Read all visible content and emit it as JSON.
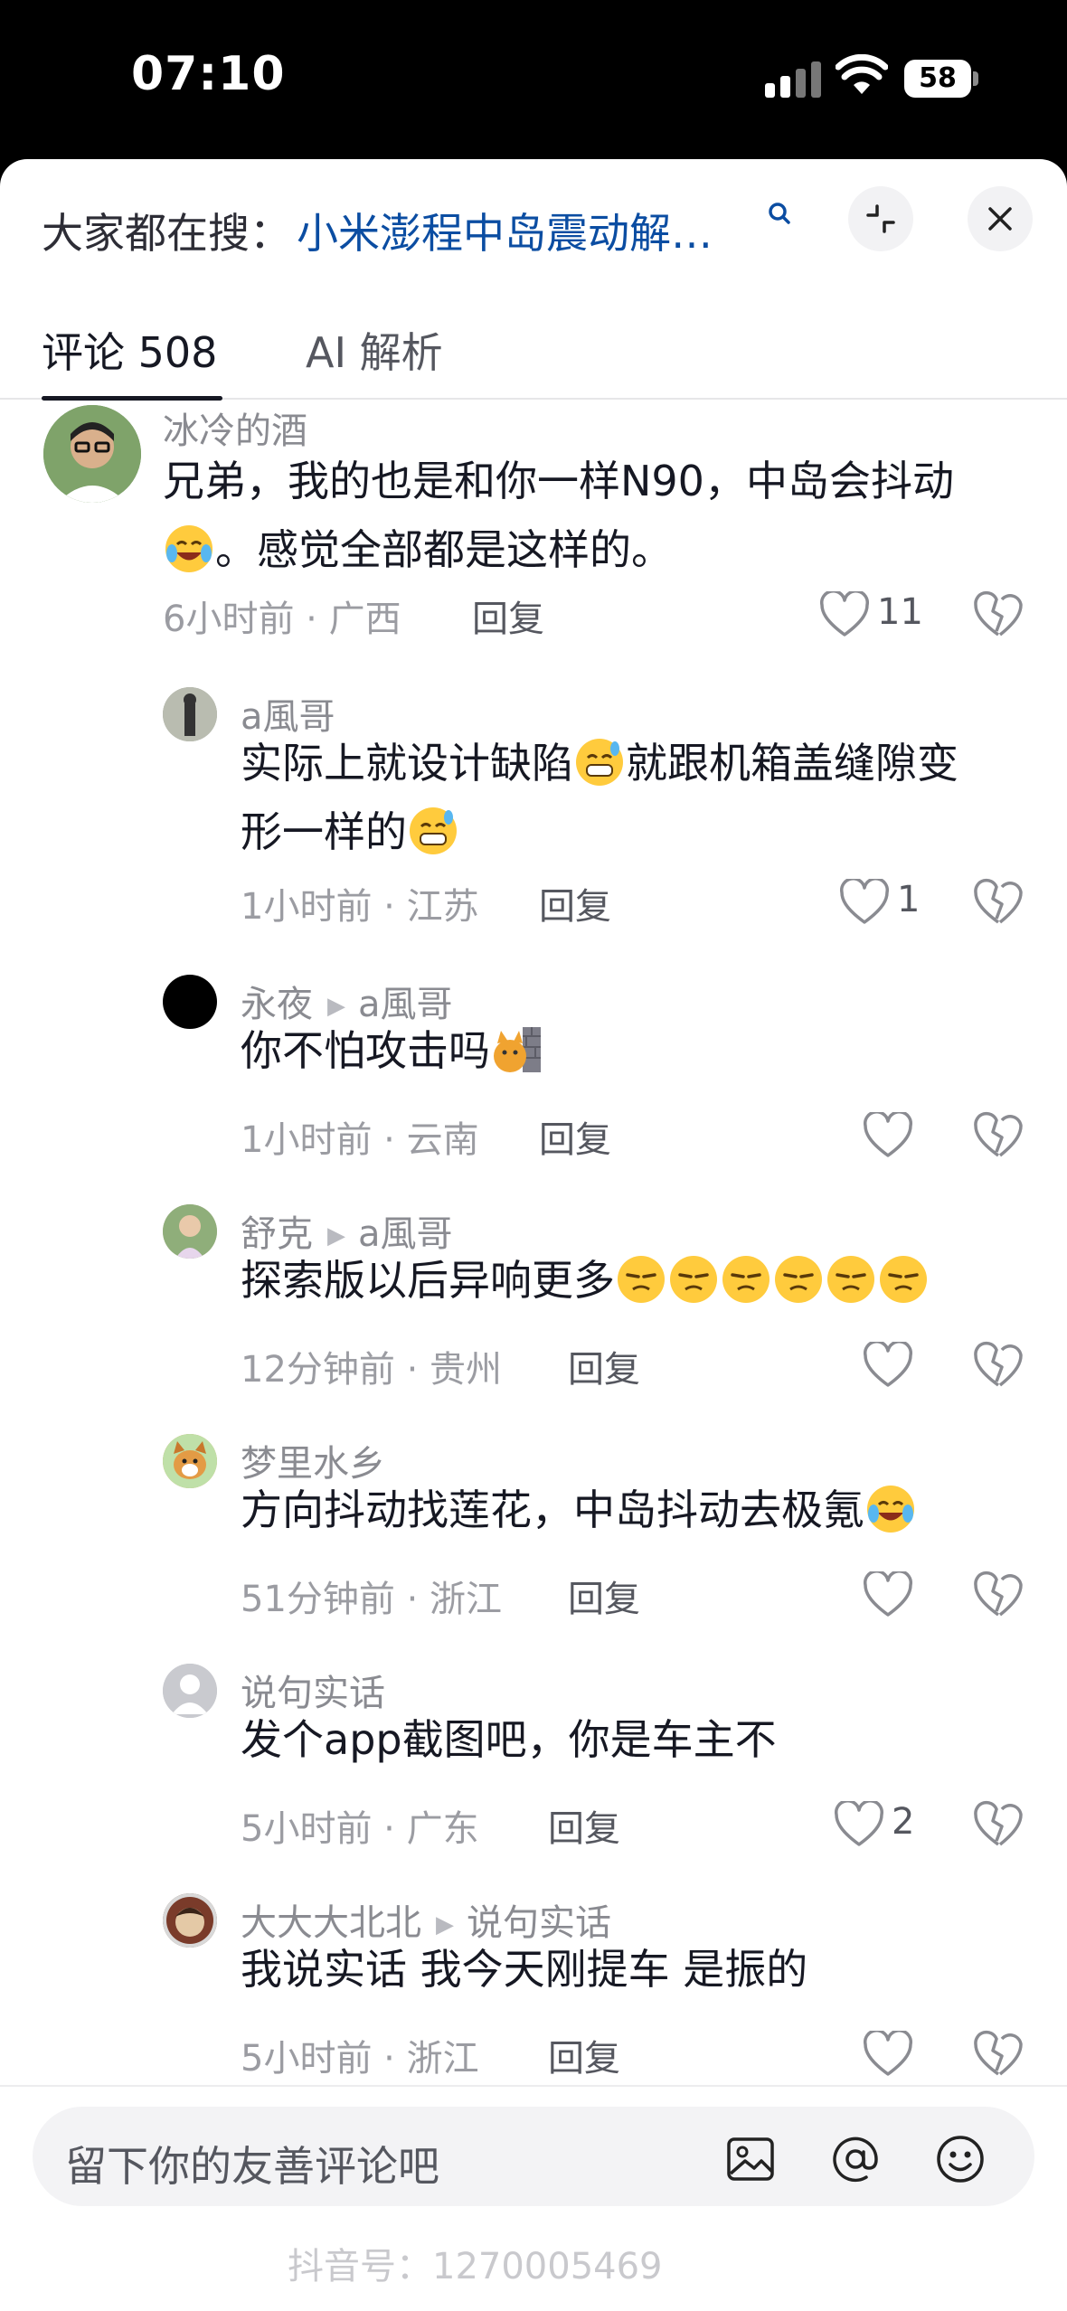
{
  "status": {
    "time": "07:10",
    "battery": "58"
  },
  "search": {
    "prefix": "大家都在搜：",
    "query": "小米澎程中岛震动解…"
  },
  "tabs": {
    "comments": "评论 508",
    "ai": "AI 解析"
  },
  "reply_label": "回复",
  "comments": [
    {
      "author": "冰冷的酒",
      "line1": "兄弟，我的也是和你一样N90，中岛会抖动",
      "line2": "。感觉全部都是这样的。",
      "meta": "6小时前 · 广西",
      "likes": "11"
    },
    {
      "author": "a風哥",
      "line1": "实际上就设计缺陷",
      "line1b": "就跟机箱盖缝隙变",
      "line2": "形一样的",
      "meta": "1小时前 · 江苏",
      "likes": "1"
    },
    {
      "author": "永夜",
      "reply_to": "a風哥",
      "line1": "你不怕攻击吗",
      "meta": "1小时前 · 云南",
      "likes": ""
    },
    {
      "author": "舒克",
      "reply_to": "a風哥",
      "line1": "探索版以后异响更多",
      "meta": "12分钟前 · 贵州",
      "likes": ""
    },
    {
      "author": "梦里水乡",
      "line1": "方向抖动找莲花，中岛抖动去极氪",
      "meta": "51分钟前 · 浙江",
      "likes": ""
    },
    {
      "author": "说句实话",
      "line1": "发个app截图吧，你是车主不",
      "meta": "5小时前 · 广东",
      "likes": "2"
    },
    {
      "author": "大大大北北",
      "reply_to": "说句实话",
      "line1": "我说实话 我今天刚提车 是振的",
      "meta": "5小时前 · 浙江",
      "likes": ""
    }
  ],
  "input": {
    "placeholder": "留下你的友善评论吧"
  },
  "watermark": "抖音号：1270005469"
}
